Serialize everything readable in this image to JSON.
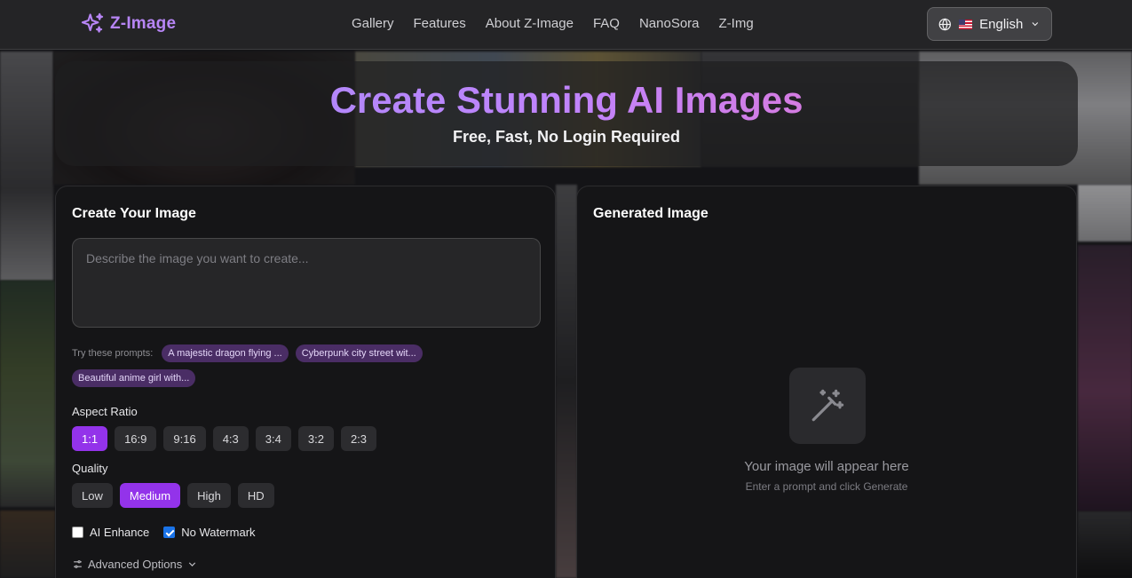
{
  "header": {
    "logo_text": "Z-Image",
    "nav": [
      "Gallery",
      "Features",
      "About Z-Image",
      "FAQ",
      "NanoSora",
      "Z-Img"
    ],
    "language": "English"
  },
  "hero": {
    "title": "Create Stunning AI Images",
    "subtitle": "Free, Fast, No Login Required"
  },
  "create": {
    "title": "Create Your Image",
    "prompt_placeholder": "Describe the image you want to create...",
    "try_label": "Try these prompts:",
    "suggestions": [
      "A majestic dragon flying ...",
      "Cyberpunk city street wit...",
      "Beautiful anime girl with..."
    ],
    "aspect_label": "Aspect Ratio",
    "aspect_ratios": [
      "1:1",
      "16:9",
      "9:16",
      "4:3",
      "3:4",
      "3:2",
      "2:3"
    ],
    "aspect_selected": "1:1",
    "quality_label": "Quality",
    "qualities": [
      "Low",
      "Medium",
      "High",
      "HD"
    ],
    "quality_selected": "Medium",
    "ai_enhance_label": "AI Enhance",
    "ai_enhance_checked": false,
    "no_watermark_label": "No Watermark",
    "no_watermark_checked": true,
    "advanced_label": "Advanced Options"
  },
  "result": {
    "title": "Generated Image",
    "empty_title": "Your image will appear here",
    "empty_subtitle": "Enter a prompt and click Generate"
  },
  "colors": {
    "accent": "#9333ea",
    "logo": "#b785f5"
  }
}
